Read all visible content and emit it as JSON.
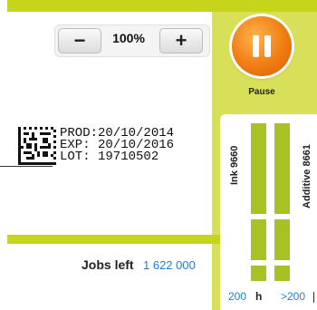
{
  "zoom": {
    "minus_label": "−",
    "level": "100%",
    "plus_label": "+"
  },
  "label_preview": {
    "lines": [
      "PROD:20/10/2014",
      "EXP: 20/10/2016",
      "LOT: 19710502"
    ]
  },
  "jobs": {
    "label": "Jobs left",
    "value": "1 622 000"
  },
  "pause": {
    "label": "Pause"
  },
  "consumables": {
    "ink": {
      "label": "Ink 9660",
      "hours": "200",
      "unit": "h"
    },
    "additive": {
      "label": "Additive 8661",
      "hours": ">200"
    }
  },
  "colors": {
    "accent": "#c7d41c",
    "gauge": "#a8c226",
    "pause": "#f07c12",
    "value": "#1d7fd6"
  }
}
